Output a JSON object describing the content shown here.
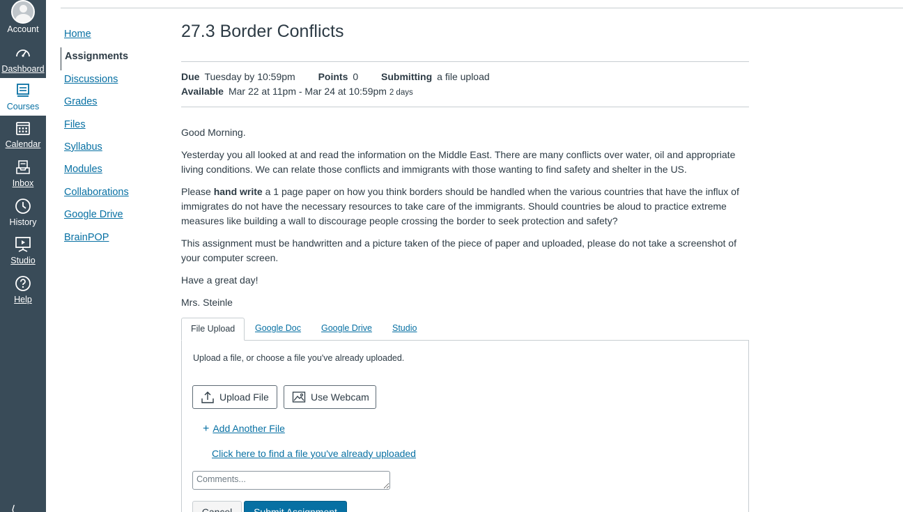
{
  "global_nav": {
    "account": "Account",
    "dashboard": "Dashboard",
    "courses": "Courses",
    "calendar": "Calendar",
    "inbox": "Inbox",
    "history": "History",
    "studio": "Studio",
    "help": "Help",
    "collapse": "⟨"
  },
  "course_nav": {
    "items": [
      "Home",
      "Assignments",
      "Discussions",
      "Grades",
      "Files",
      "Syllabus",
      "Modules",
      "Collaborations",
      "Google Drive",
      "BrainPOP"
    ],
    "active": "Assignments"
  },
  "assignment": {
    "title": "27.3 Border Conflicts",
    "due_label": "Due",
    "due_value": "Tuesday by 10:59pm",
    "points_label": "Points",
    "points_value": "0",
    "submitting_label": "Submitting",
    "submitting_value": "a file upload",
    "available_label": "Available",
    "available_value": "Mar 22 at 11pm - Mar 24 at 10:59pm",
    "available_duration": "2 days"
  },
  "description": {
    "greeting": "Good Morning.",
    "para1": "Yesterday you all looked at and read the information on the Middle East.  There are many conflicts over water, oil and appropriate living conditions.  We can relate those conflicts and immigrants with those wanting to find safety and shelter in the US.",
    "para2_prefix": "Please ",
    "para2_bold": "hand write",
    "para2_suffix": " a 1 page paper on how you think borders should be handled when the various countries that have the influx of immigrates do not have the necessary resources to take care of the immigrants.  Should countries be aloud to practice extreme measures like building a wall to discourage people crossing the border to seek protection and safety?",
    "para3": "This assignment must be handwritten and a picture taken of the piece of paper and uploaded, please do not take a screenshot of your computer screen.",
    "closing": "Have a great day!",
    "signature": "Mrs. Steinle"
  },
  "submission": {
    "tabs": [
      "File Upload",
      "Google Doc",
      "Google Drive",
      "Studio"
    ],
    "active_tab": "File Upload",
    "hint": "Upload a file, or choose a file you've already uploaded.",
    "upload_button": "Upload File",
    "webcam_button": "Use Webcam",
    "add_file": "Add Another File",
    "find_file": "Click here to find a file you've already uploaded",
    "comments_placeholder": "Comments...",
    "cancel_button": "Cancel",
    "submit_button": "Submit Assignment"
  },
  "colors": {
    "nav_bg": "#394b58",
    "link": "#0770a3",
    "text": "#2d3b45",
    "primary_button": "#0770a3"
  }
}
